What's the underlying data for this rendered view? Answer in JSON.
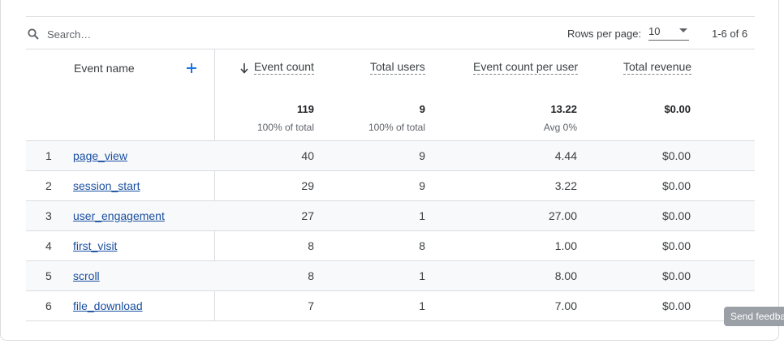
{
  "search": {
    "placeholder": "Search…"
  },
  "pagination": {
    "rows_per_page_label": "Rows per page:",
    "rows_per_page_value": "10",
    "range": "1-6 of 6"
  },
  "columns": {
    "event_name": "Event name",
    "event_count": "Event count",
    "total_users": "Total users",
    "event_count_per_user": "Event count per user",
    "total_revenue": "Total revenue"
  },
  "totals": {
    "event_count": "119",
    "event_count_sub": "100% of total",
    "total_users": "9",
    "total_users_sub": "100% of total",
    "per_user": "13.22",
    "per_user_sub": "Avg 0%",
    "revenue": "$0.00"
  },
  "rows": [
    {
      "index": "1",
      "event": "page_view",
      "count": "40",
      "users": "9",
      "per_user": "4.44",
      "revenue": "$0.00"
    },
    {
      "index": "2",
      "event": "session_start",
      "count": "29",
      "users": "9",
      "per_user": "3.22",
      "revenue": "$0.00"
    },
    {
      "index": "3",
      "event": "user_engagement",
      "count": "27",
      "users": "1",
      "per_user": "27.00",
      "revenue": "$0.00"
    },
    {
      "index": "4",
      "event": "first_visit",
      "count": "8",
      "users": "8",
      "per_user": "1.00",
      "revenue": "$0.00"
    },
    {
      "index": "5",
      "event": "scroll",
      "count": "8",
      "users": "1",
      "per_user": "8.00",
      "revenue": "$0.00"
    },
    {
      "index": "6",
      "event": "file_download",
      "count": "7",
      "users": "1",
      "per_user": "7.00",
      "revenue": "$0.00"
    }
  ],
  "feedback_label": "Send feedback",
  "colors": {
    "link": "#1a4fa0",
    "add_button": "#1a73e8",
    "row_shade": "#f8f9fa",
    "divider": "#dadce0"
  }
}
